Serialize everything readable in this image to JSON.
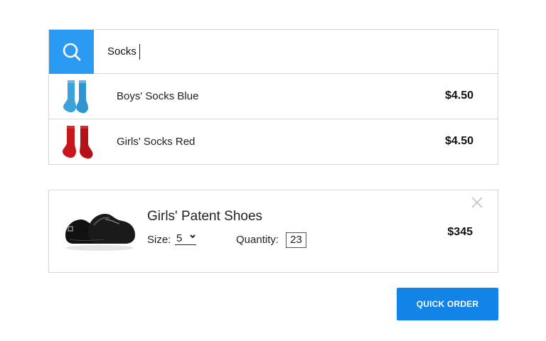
{
  "search": {
    "query": "Socks",
    "results": [
      {
        "name": "Boys' Socks Blue",
        "price": "$4.50",
        "thumb_color": "#3aa3dc"
      },
      {
        "name": "Girls' Socks Red",
        "price": "$4.50",
        "thumb_color": "#c8161a"
      }
    ]
  },
  "cart": {
    "item": {
      "title": "Girls' Patent Shoes",
      "size_label": "Size:",
      "size_value": "5",
      "quantity_label": "Quantity:",
      "quantity_value": "23",
      "price": "$345"
    }
  },
  "actions": {
    "quick_order_label": "QUICK ORDER"
  },
  "colors": {
    "search_button": "#2b9af3",
    "quick_order_button": "#1284e8"
  },
  "icons": {
    "search": "search-icon",
    "close": "close-icon",
    "chevron": "chevron-down-icon"
  }
}
